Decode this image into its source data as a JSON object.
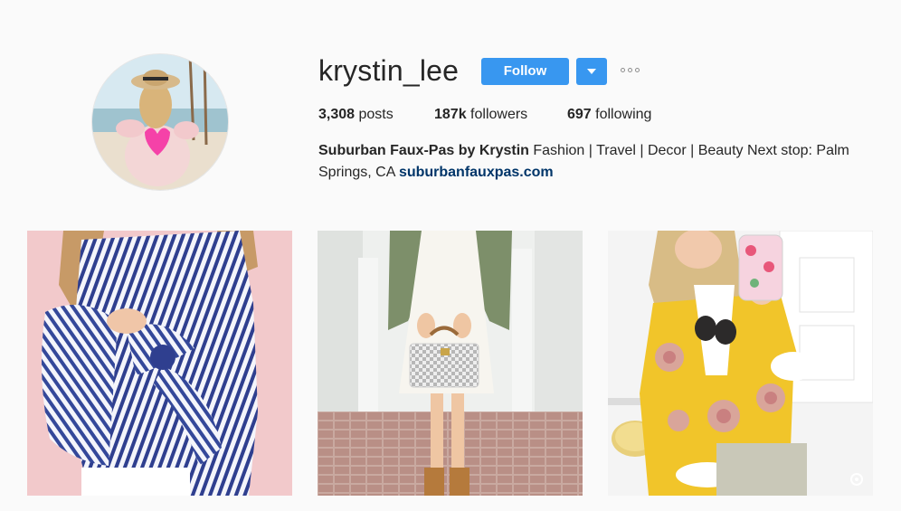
{
  "profile": {
    "username": "krystin_lee",
    "follow_label": "Follow",
    "dropdown_icon": "caret-down-icon",
    "more_icon": "ellipsis-icon",
    "accent_color": "#3897f0",
    "link_color": "#003569"
  },
  "stats": {
    "posts_count": "3,308",
    "posts_label": "posts",
    "followers_count": "187k",
    "followers_label": "followers",
    "following_count": "697",
    "following_label": "following"
  },
  "bio": {
    "full_name": "Suburban Faux-Pas by Krystin",
    "text": " Fashion | Travel | Decor | Beauty Next stop: Palm Springs, CA ",
    "link": "suburbanfauxpas.com"
  },
  "posts": [
    {
      "icon": "photo-icon"
    },
    {
      "icon": "photo-icon"
    },
    {
      "icon": "photo-icon",
      "badge_icon": "carousel-icon"
    }
  ]
}
